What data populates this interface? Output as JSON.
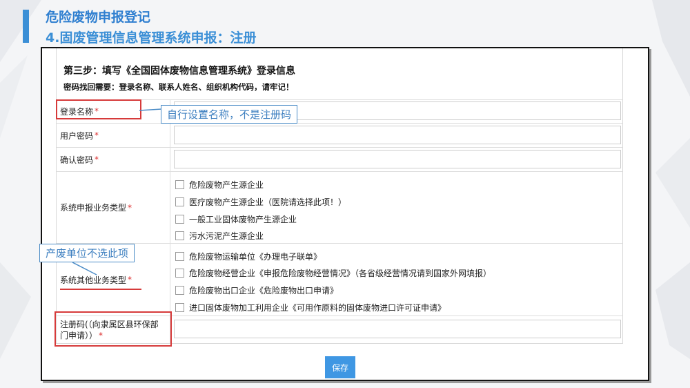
{
  "header": {
    "title": "危险废物申报登记",
    "subtitle": "4.固废管理信息管理系统申报：注册"
  },
  "form": {
    "step_title": "第三步：填写《全国固体废物信息管理系统》登录信息",
    "step_note": "密码找回需要：登录名称、联系人姓名、组织机构代码，请牢记！",
    "required_mark": "*",
    "fields": {
      "login_name": {
        "label": "登录名称",
        "value": ""
      },
      "password": {
        "label": "用户密码",
        "value": ""
      },
      "confirm_password": {
        "label": "确认密码",
        "value": ""
      },
      "business_type": {
        "label": "系统申报业务类型",
        "options": [
          {
            "label": "危险废物产生源企业",
            "checked": false
          },
          {
            "label": "医疗废物产生源企业（医院请选择此项！）",
            "checked": false
          },
          {
            "label": "一般工业固体废物产生源企业",
            "checked": false
          },
          {
            "label": "污水污泥产生源企业",
            "checked": false
          }
        ]
      },
      "other_business_type": {
        "label": "系统其他业务类型",
        "options": [
          {
            "label": "危险废物运输单位《办理电子联单》",
            "checked": false
          },
          {
            "label": "危险废物经营企业《申报危险废物经营情况》（各省级经营情况请到国家外网填报）",
            "checked": false
          },
          {
            "label": "危险废物出口企业《危险废物出口申请》",
            "checked": false
          },
          {
            "label": "进口固体废物加工利用企业《可用作原料的固体废物进口许可证申请》",
            "checked": false
          }
        ]
      },
      "registration_code": {
        "label_line1": "注册码(（向隶属区县环保部",
        "label_line2": "门申请））",
        "value": ""
      }
    },
    "save_label": "保存"
  },
  "annotations": {
    "login_name_note": "自行设置名称，不是注册码",
    "other_type_note": "产废单位不选此项"
  },
  "colors": {
    "accent": "#3b8fd6",
    "annotation_red": "#d63a3a",
    "button": "#3f97e3"
  }
}
